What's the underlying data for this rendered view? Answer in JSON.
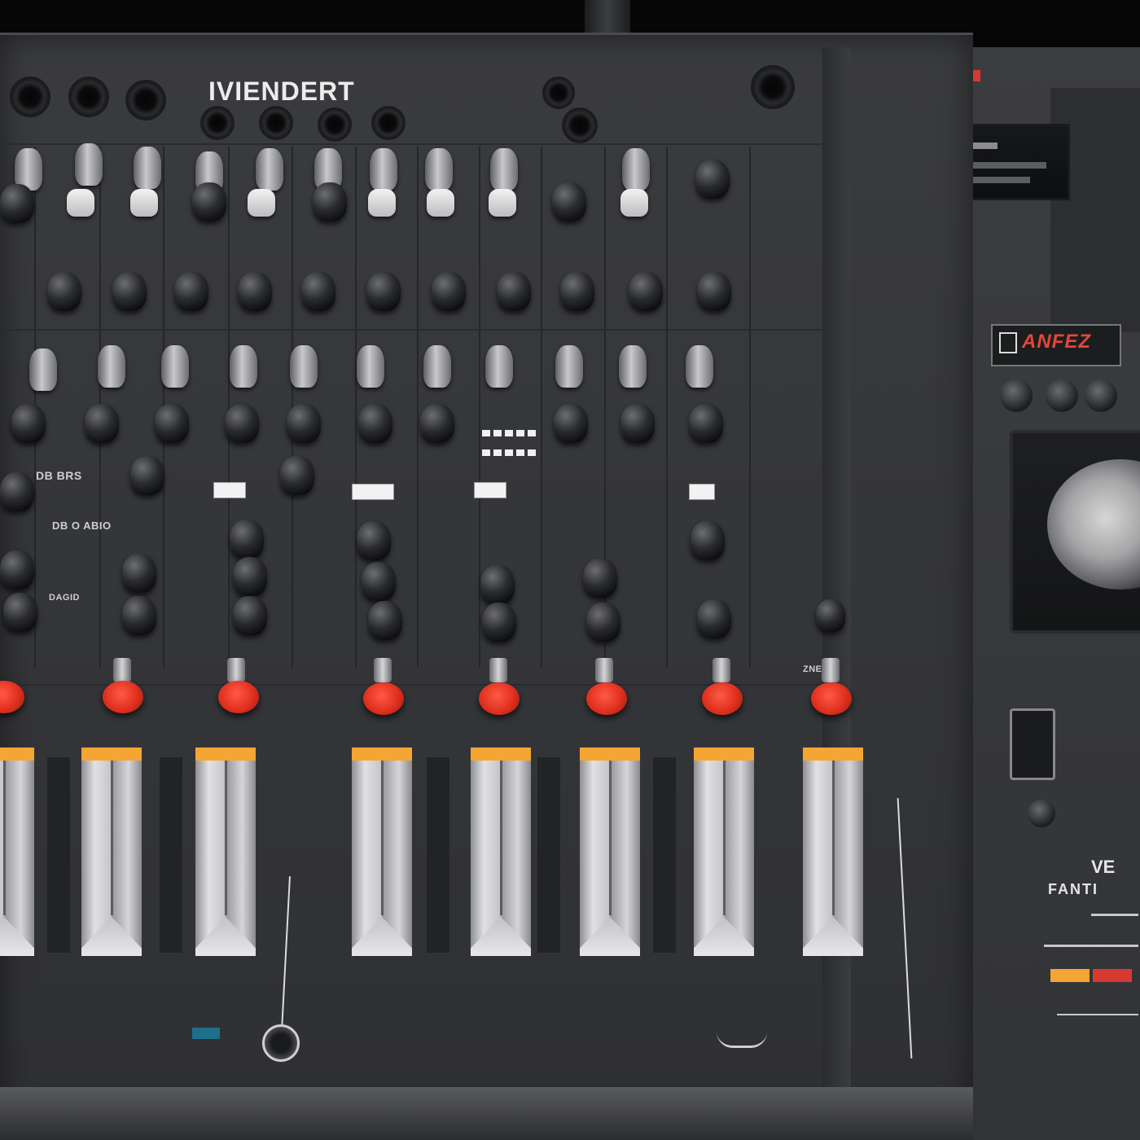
{
  "brand": {
    "name": "IVIENDERT"
  },
  "side_panel": {
    "label_ve": "VE",
    "label_santi": "FANTI",
    "brand_badge": "ANFEZ",
    "colors": {
      "orange": "#f4a533",
      "red": "#d63a2e"
    }
  },
  "labels": [
    "DB BRS",
    "DB O ABIO",
    "DAGID",
    "ZNESS"
  ],
  "colors": {
    "panel": "#36373a",
    "fader_cap": "#f4a533",
    "knob_red": "#e0301f"
  }
}
